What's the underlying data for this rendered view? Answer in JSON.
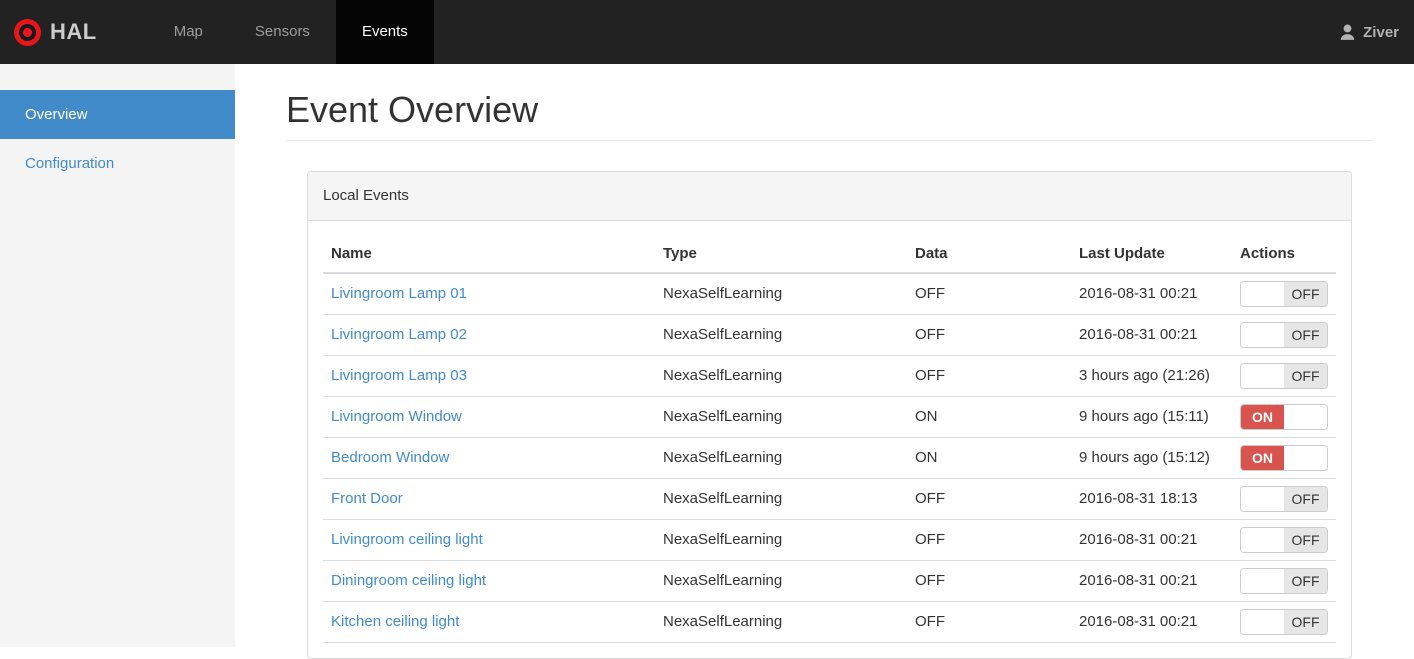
{
  "navbar": {
    "brand": "HAL",
    "items": [
      {
        "label": "Map",
        "active": false
      },
      {
        "label": "Sensors",
        "active": false
      },
      {
        "label": "Events",
        "active": true
      }
    ],
    "user": "Ziver"
  },
  "sidebar": {
    "items": [
      {
        "label": "Overview",
        "active": true
      },
      {
        "label": "Configuration",
        "active": false
      }
    ]
  },
  "page": {
    "title": "Event Overview"
  },
  "panel": {
    "title": "Local Events",
    "table": {
      "columns": [
        "Name",
        "Type",
        "Data",
        "Last Update",
        "Actions"
      ],
      "rows": [
        {
          "name": "Livingroom Lamp 01",
          "type": "NexaSelfLearning",
          "data": "OFF",
          "last_update": "2016-08-31 00:21",
          "toggle": "OFF"
        },
        {
          "name": "Livingroom Lamp 02",
          "type": "NexaSelfLearning",
          "data": "OFF",
          "last_update": "2016-08-31 00:21",
          "toggle": "OFF"
        },
        {
          "name": "Livingroom Lamp 03",
          "type": "NexaSelfLearning",
          "data": "OFF",
          "last_update": "3 hours ago (21:26)",
          "toggle": "OFF"
        },
        {
          "name": "Livingroom Window",
          "type": "NexaSelfLearning",
          "data": "ON",
          "last_update": "9 hours ago (15:11)",
          "toggle": "ON"
        },
        {
          "name": "Bedroom Window",
          "type": "NexaSelfLearning",
          "data": "ON",
          "last_update": "9 hours ago (15:12)",
          "toggle": "ON"
        },
        {
          "name": "Front Door",
          "type": "NexaSelfLearning",
          "data": "OFF",
          "last_update": "2016-08-31 18:13",
          "toggle": "OFF"
        },
        {
          "name": "Livingroom ceiling light",
          "type": "NexaSelfLearning",
          "data": "OFF",
          "last_update": "2016-08-31 00:21",
          "toggle": "OFF"
        },
        {
          "name": "Diningroom ceiling light",
          "type": "NexaSelfLearning",
          "data": "OFF",
          "last_update": "2016-08-31 00:21",
          "toggle": "OFF"
        },
        {
          "name": "Kitchen ceiling light",
          "type": "NexaSelfLearning",
          "data": "OFF",
          "last_update": "2016-08-31 00:21",
          "toggle": "OFF"
        }
      ]
    }
  },
  "colors": {
    "navbar_bg": "#222222",
    "navbar_active_bg": "#050505",
    "accent_blue": "#428bca",
    "toggle_on_red": "#d9534f",
    "logo_red": "#e8151b",
    "sidebar_bg": "#f4f4f4",
    "panel_heading_bg": "#f5f5f5"
  }
}
